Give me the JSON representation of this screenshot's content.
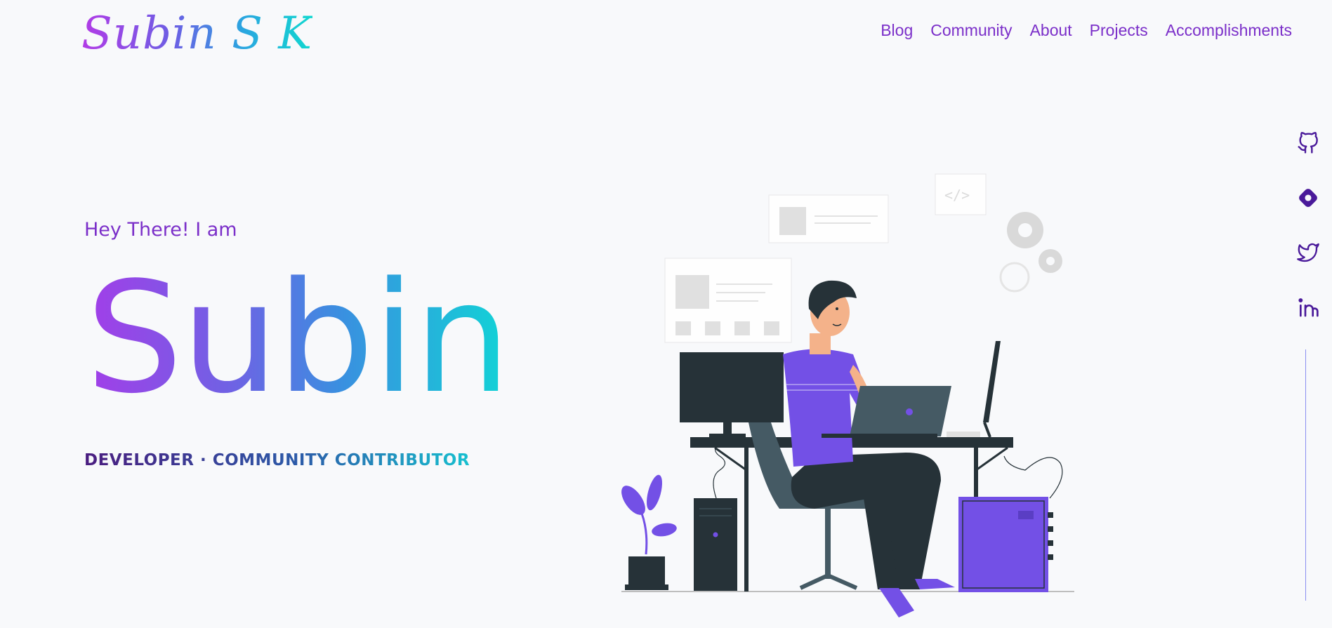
{
  "header": {
    "logo": "Subin S K",
    "nav": [
      {
        "label": "Blog"
      },
      {
        "label": "Community"
      },
      {
        "label": "About"
      },
      {
        "label": "Projects"
      },
      {
        "label": "Accomplishments"
      }
    ]
  },
  "hero": {
    "greeting": "Hey There! I am",
    "name": "Subin",
    "roles": "DEVELOPER · COMMUNITY CONTRIBUTOR"
  },
  "social": [
    {
      "icon": "github-icon"
    },
    {
      "icon": "hashnode-icon"
    },
    {
      "icon": "twitter-icon"
    },
    {
      "icon": "linkedin-icon"
    }
  ],
  "colors": {
    "accent": "#7b2fc9",
    "background": "#f8f9fb",
    "dark": "#263238",
    "purple": "#7350e6",
    "social_icon": "#4a1a9a"
  }
}
